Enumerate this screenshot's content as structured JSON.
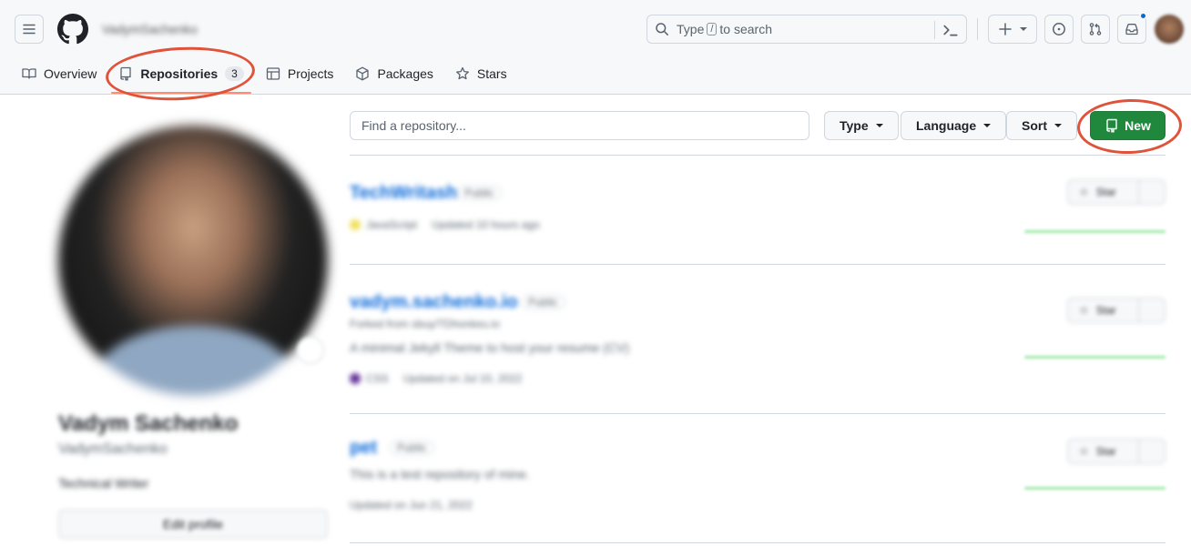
{
  "header": {
    "username": "VadymSachenko",
    "search": {
      "prefix": "Type",
      "key": "/",
      "suffix": "to search"
    }
  },
  "tabs": [
    {
      "label": "Overview"
    },
    {
      "label": "Repositories",
      "count": "3"
    },
    {
      "label": "Projects"
    },
    {
      "label": "Packages"
    },
    {
      "label": "Stars"
    }
  ],
  "profile": {
    "full_name": "Vadym Sachenko",
    "handle": "VadymSachenko",
    "bio": "Technical Writer",
    "edit_label": "Edit profile"
  },
  "repo_toolbar": {
    "find_placeholder": "Find a repository...",
    "type_label": "Type",
    "language_label": "Language",
    "sort_label": "Sort",
    "new_label": "New"
  },
  "repos": [
    {
      "name": "TechWritash",
      "visibility": "Public",
      "description": "",
      "description2": "",
      "language": "JavaScript",
      "language_color": "#f1e05a",
      "updated": "Updated 10 hours ago",
      "star_label": "Star"
    },
    {
      "name": "vadym.sachenko.io",
      "visibility": "Public",
      "description": "Forked from sbuy/TDhonkeu.io",
      "description2": "A minimal Jekyll Theme to host your resume (CV)",
      "language": "CSS",
      "language_color": "#663399",
      "updated": "Updated on Jul 10, 2022",
      "star_label": "Star"
    },
    {
      "name": "pet",
      "visibility": "Public",
      "description": "This is a test repository of mine.",
      "description2": "",
      "language": "",
      "language_color": "",
      "updated": "Updated on Jun 21, 2022",
      "star_label": "Star"
    }
  ],
  "colors": {
    "accent_green": "#1f883d",
    "link_blue": "#0969da",
    "highlight_red": "#e0533a",
    "tab_underline": "#fd8c73"
  }
}
